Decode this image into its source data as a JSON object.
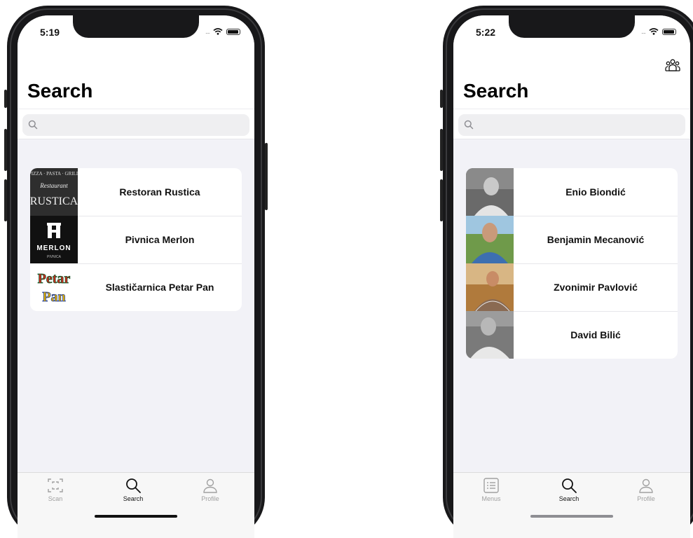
{
  "left_phone": {
    "status_time": "5:19",
    "title": "Search",
    "search": {
      "placeholder": ""
    },
    "results": [
      {
        "name": "Restoran Rustica",
        "thumb": "rustica-logo"
      },
      {
        "name": "Pivnica Merlon",
        "thumb": "merlon-logo"
      },
      {
        "name": "Slastičarnica Petar Pan",
        "thumb": "petar-pan-logo"
      }
    ],
    "tabs": [
      {
        "label": "Scan",
        "icon": "scan-icon",
        "active": false
      },
      {
        "label": "Search",
        "icon": "search-icon",
        "active": true
      },
      {
        "label": "Profile",
        "icon": "profile-icon",
        "active": false
      }
    ],
    "logo_texts": {
      "rustica_top": "PIZZA · PASTA · GRILL",
      "rustica_mid": "Restaurant",
      "rustica_main": "RUSTICA",
      "merlon_main": "MERLON",
      "merlon_sub": "PIVNICA",
      "petar": "Petar",
      "pan": "Pan"
    }
  },
  "right_phone": {
    "status_time": "5:22",
    "title": "Search",
    "search": {
      "placeholder": ""
    },
    "top_right_icon": "people-group-icon",
    "results": [
      {
        "name": "Enio Biondić",
        "thumb": "avatar-photo"
      },
      {
        "name": "Benjamin Mecanović",
        "thumb": "avatar-photo"
      },
      {
        "name": "Zvonimir Pavlović",
        "thumb": "avatar-photo"
      },
      {
        "name": "David Bilić",
        "thumb": "avatar-photo"
      }
    ],
    "tabs": [
      {
        "label": "Menus",
        "icon": "menu-list-icon",
        "active": false
      },
      {
        "label": "Search",
        "icon": "search-icon",
        "active": true
      },
      {
        "label": "Profile",
        "icon": "profile-icon",
        "active": false
      }
    ]
  },
  "colors": {
    "list_background": "#f2f2f7",
    "active_tab": "#111111",
    "inactive_tab": "#a0a0a0"
  }
}
